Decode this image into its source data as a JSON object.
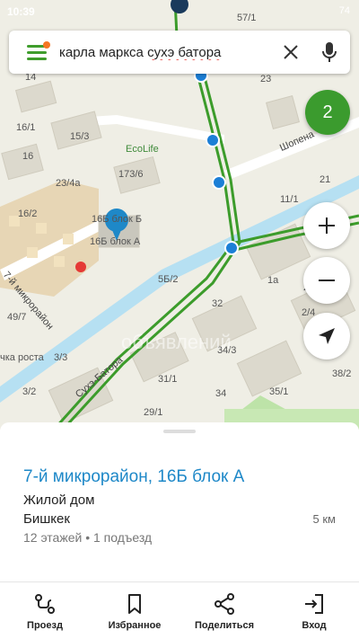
{
  "status_bar": {
    "time": "10:39",
    "battery": "74"
  },
  "search": {
    "text_plain": "карла маркса ",
    "text_err": "сухэ батора"
  },
  "badge": {
    "count": "2"
  },
  "map": {
    "buildings": [
      "14",
      "16/1",
      "16",
      "15/3",
      "EcoLife",
      "173/6",
      "23/4а",
      "16/2",
      "16Б блок Б",
      "16Б блок А",
      "7-й микрорайон",
      "49/7",
      "чка роста",
      "3/3",
      "3/2",
      "5Б/2",
      "32",
      "31/1",
      "34/3",
      "34",
      "35/1",
      "29/1",
      "38/2",
      "11/1",
      "21",
      "1а",
      "2/4",
      "57/1",
      "23",
      "2"
    ],
    "streets": [
      "Шопена",
      "Сухэ-Батора"
    ],
    "watermark": "объявлений"
  },
  "place": {
    "title": "7-й микрорайон, 16Б блок А",
    "type": "Жилой дом",
    "city": "Бишкек",
    "distance": "5 км",
    "info": "12 этажей • 1 подъезд"
  },
  "actions": [
    {
      "label": "Проезд",
      "icon": "route-icon"
    },
    {
      "label": "Избранное",
      "icon": "bookmark-icon"
    },
    {
      "label": "Поделиться",
      "icon": "share-icon"
    },
    {
      "label": "Вход",
      "icon": "entrance-icon"
    }
  ],
  "colors": {
    "accent_green": "#3b9b2e",
    "link_blue": "#1e88c8",
    "route_blue": "#1c7fd6",
    "orange_dot": "#f57623"
  }
}
